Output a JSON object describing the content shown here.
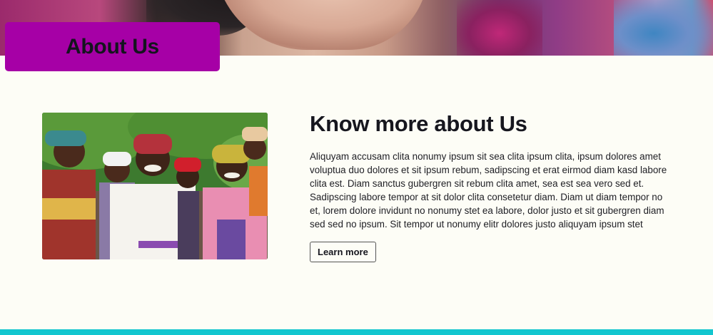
{
  "hero": {
    "badge_title": "About Us",
    "badge_color": "#a600a6"
  },
  "about": {
    "heading": "Know more about Us",
    "body": "Aliquyam accusam clita nonumy ipsum sit sea clita ipsum clita, ipsum dolores amet voluptua duo dolores et sit ipsum rebum, sadipscing et erat eirmod diam kasd labore clita est. Diam sanctus gubergren sit rebum clita amet, sea est sea vero sed et. Sadipscing labore tempor at sit dolor clita consetetur diam. Diam ut diam tempor no et, lorem dolore invidunt no nonumy stet ea labore, dolor justo et sit gubergren diam sed sed no ipsum. Sit tempor ut nonumy elitr dolores justo aliquyam ipsum stet",
    "button_label": "Learn more"
  },
  "footer": {
    "accent_color": "#12c6cf"
  }
}
